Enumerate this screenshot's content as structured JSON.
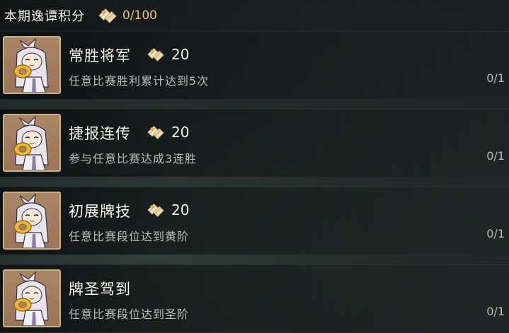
{
  "header": {
    "title": "本期逸谭积分",
    "score": "0/100",
    "icon": "scroll-points-icon"
  },
  "colors": {
    "score": "#e3c46a",
    "avatar_border": "#c9b184",
    "avatar_bg": "#a98564"
  },
  "tasks": [
    {
      "title": "常胜将军",
      "reward": "20",
      "description": "任意比赛胜利累计达到5次",
      "progress": "0/1"
    },
    {
      "title": "捷报连传",
      "reward": "20",
      "description": "参与任意比赛达成3连胜",
      "progress": "0/1"
    },
    {
      "title": "初展牌技",
      "reward": "20",
      "description": "任意比赛段位达到黄阶",
      "progress": "0/1"
    },
    {
      "title": "牌圣驾到",
      "description": "任意比赛段位达到圣阶",
      "progress": "0/1"
    }
  ]
}
